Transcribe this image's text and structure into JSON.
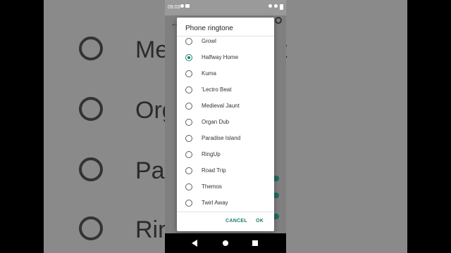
{
  "status_bar": {
    "time": "09:03"
  },
  "dialog": {
    "title": "Phone ringtone",
    "options": [
      {
        "label": "Growl",
        "selected": false
      },
      {
        "label": "Halfway Home",
        "selected": true
      },
      {
        "label": "Kuma",
        "selected": false
      },
      {
        "label": "'Lectro Beat",
        "selected": false
      },
      {
        "label": "Medieval Jaunt",
        "selected": false
      },
      {
        "label": "Organ Dub",
        "selected": false
      },
      {
        "label": "Paradise Island",
        "selected": false
      },
      {
        "label": "RingUp",
        "selected": false
      },
      {
        "label": "Road Trip",
        "selected": false
      },
      {
        "label": "Themos",
        "selected": false
      },
      {
        "label": "Twirl Away",
        "selected": false
      }
    ],
    "cancel_label": "CANCEL",
    "ok_label": "OK"
  },
  "background_left": {
    "rows": [
      "Me",
      "Org",
      "Par",
      "Rin"
    ]
  },
  "background_right": {
    "rows": [
      "t",
      "",
      "l",
      ""
    ]
  },
  "colors": {
    "accent": "#1a7f6e"
  }
}
